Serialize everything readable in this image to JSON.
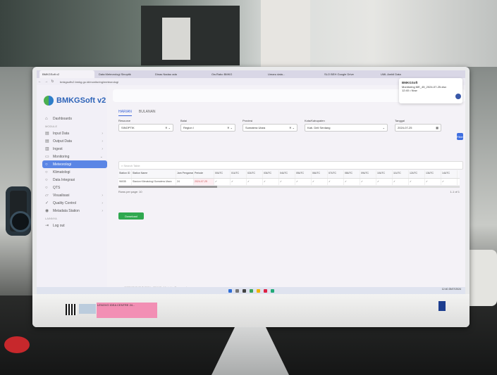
{
  "browser": {
    "tabs": [
      "BMKGSoft v2",
      "Data Meteorologi Sinoptik",
      "Dinas Nadao ada",
      "Ow.Rabo BMKG",
      "Umaru data...",
      "SLO BEH Google Drive",
      "UML Ambil Data"
    ],
    "url": "bmkgsoftv2.bmkg.go.id/monitoring/meteorologi"
  },
  "brand": {
    "name": "BMKGSoft v2"
  },
  "sidebar": {
    "dashboard": "Dashboards",
    "section_modul": "MODULE",
    "items": [
      {
        "label": "Input Data",
        "icon": "document-icon"
      },
      {
        "label": "Output Data",
        "icon": "document-icon"
      },
      {
        "label": "Ingest",
        "icon": "database-icon"
      },
      {
        "label": "Monitoring",
        "icon": "monitor-icon"
      },
      {
        "label": "Meteorologi",
        "icon": "circle-icon",
        "active": true
      },
      {
        "label": "Klimatologi",
        "icon": "circle-icon"
      },
      {
        "label": "Data Integrasi",
        "icon": "circle-icon"
      },
      {
        "label": "QTS",
        "icon": "circle-icon"
      },
      {
        "label": "Visualisasi",
        "icon": "chart-icon"
      },
      {
        "label": "Quality Control",
        "icon": "check-icon"
      },
      {
        "label": "Metadata Station",
        "icon": "station-icon"
      }
    ],
    "section_lainnya": "LAINNYA",
    "logout": "Log out"
  },
  "notification": {
    "title": "BMKGSoft",
    "body": "Monitoring ME_45_2024-07-25.xlsx",
    "time": "12:40 • Now"
  },
  "page_tabs": [
    "HARIAN",
    "BULANAN"
  ],
  "filters": [
    {
      "label": "Resource",
      "value": "SINOPTIK"
    },
    {
      "label": "Balai",
      "value": "Region I"
    },
    {
      "label": "Provinsi",
      "value": "Sumatera Utara"
    },
    {
      "label": "Kota/Kabupaten",
      "value": "Kab. Deli Serdang"
    },
    {
      "label": "Tanggal",
      "value": "2024-07-25"
    }
  ],
  "filter_button": "Filter",
  "table": {
    "search_placeholder": "Search Table",
    "columns": [
      "Station ID",
      "Station Name",
      "Jam Pengamatan",
      "Periode",
      "00UTC",
      "01UTC",
      "02UTC",
      "03UTC",
      "04UTC",
      "05UTC",
      "06UTC",
      "07UTC",
      "08UTC",
      "09UTC",
      "10UTC",
      "11UTC",
      "12UTC",
      "13UTC",
      "14UTC"
    ],
    "rows": [
      [
        "96035",
        "Stasiun Klimatologi Sumatera Utara",
        "24",
        "2024-07-25",
        "✓",
        "✓",
        "✓",
        "✓",
        "✓",
        "✓",
        "✓",
        "✓",
        "✓",
        "✓",
        "✓",
        "✓",
        "✓",
        "✓",
        "✓"
      ]
    ],
    "rows_per_page": "Rows per page: 10",
    "pagination": "1-1 of 1"
  },
  "download_button": "Download",
  "copyright": "COPYRIGHT © 2024 - BMKG, All rights Reserved",
  "tray": {
    "time": "12:40",
    "date": "25/07/2024"
  },
  "sticker_note": "LENOVO IDEA CENTRE 24..."
}
